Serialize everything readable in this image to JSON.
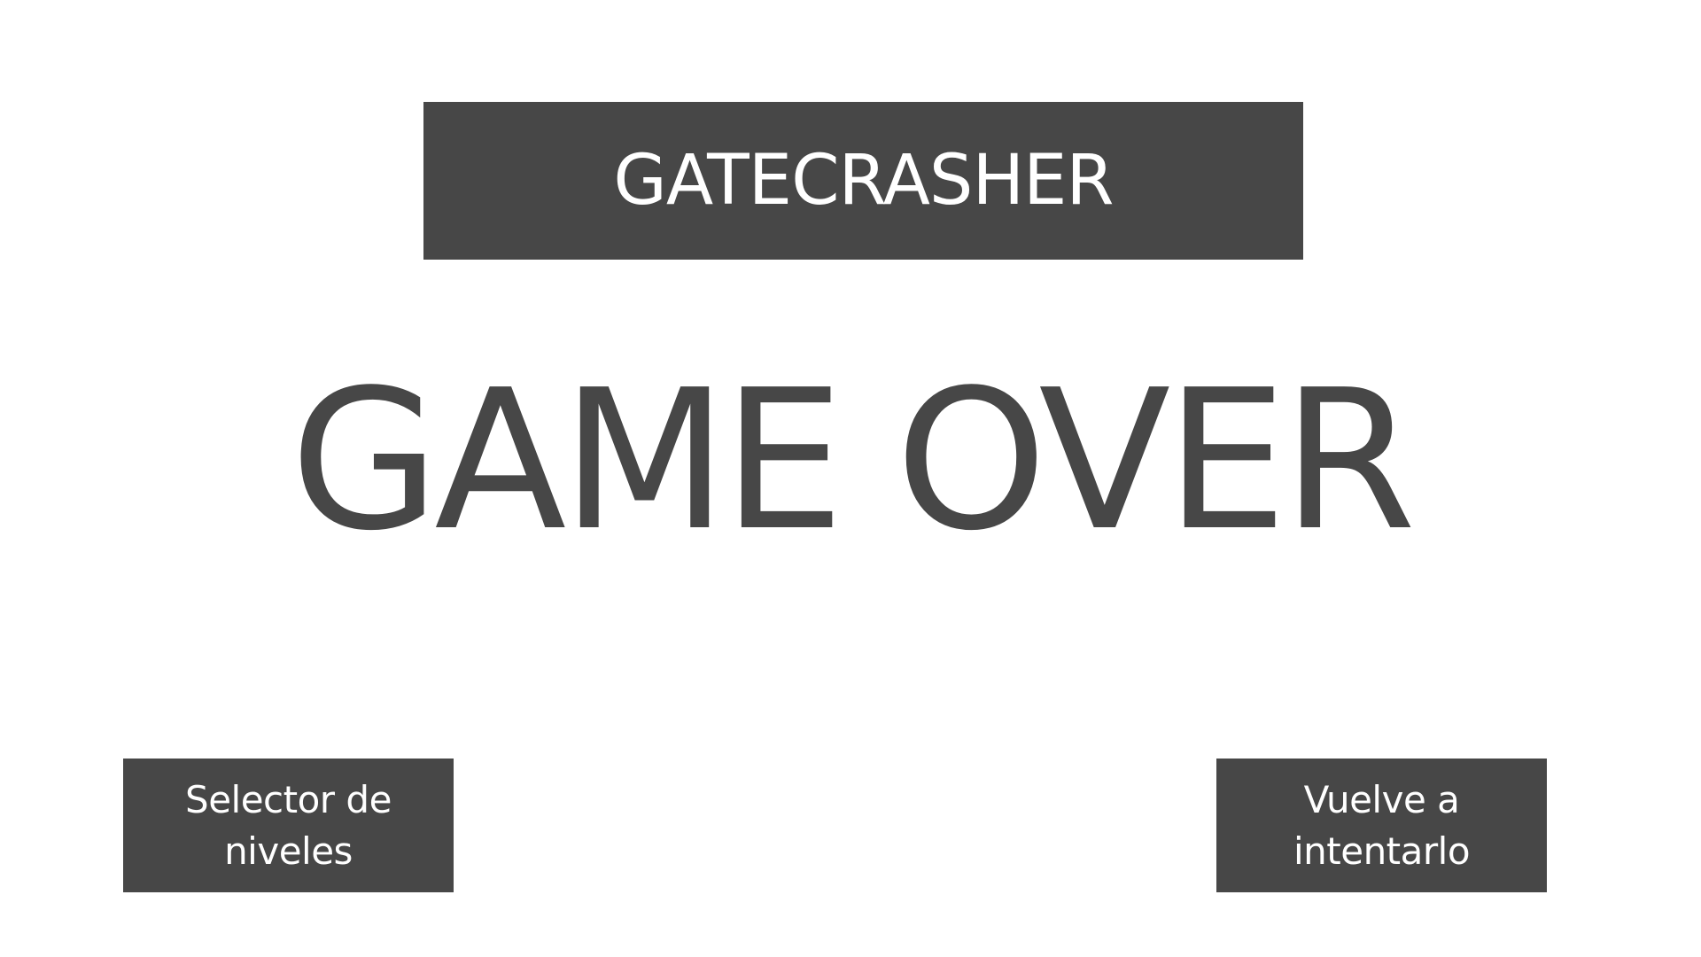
{
  "header": {
    "title": "GATECRASHER"
  },
  "main": {
    "message": "GAME OVER"
  },
  "buttons": {
    "level_selector_label": "Selector de niveles",
    "retry_label": "Vuelve a intentarlo"
  },
  "colors": {
    "panel": "#474747",
    "background": "#ffffff",
    "text_light": "#ffffff"
  }
}
